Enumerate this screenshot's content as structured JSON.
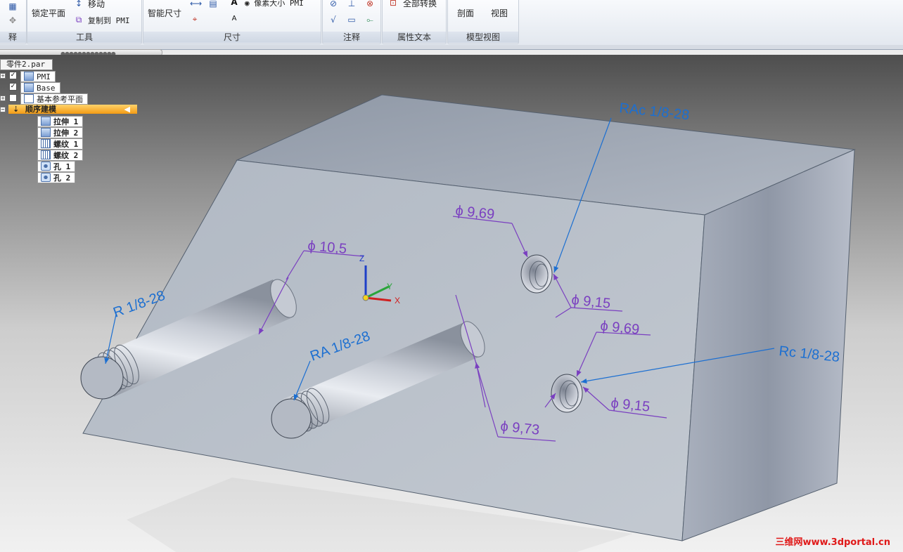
{
  "ribbon": {
    "groups": [
      {
        "label": "释"
      },
      {
        "label": "工具",
        "buttons": [
          "锁定平面",
          "移动",
          "复制到 PMI"
        ]
      },
      {
        "label": "尺寸",
        "buttons": [
          "智能尺寸",
          "像素大小 PMI"
        ]
      },
      {
        "label": "注释"
      },
      {
        "label": "属性文本",
        "buttons": [
          "全部转换"
        ]
      },
      {
        "label": "模型视图",
        "buttons": [
          "剖面",
          "视图"
        ]
      }
    ]
  },
  "tree": {
    "doc_tab": "零件2.par",
    "items": [
      {
        "label": "PMI",
        "checked": true
      },
      {
        "label": "Base",
        "checked": true
      },
      {
        "label": "基本参考平面",
        "checked": false
      },
      {
        "label": "顺序建模"
      },
      {
        "label": "拉伸 1"
      },
      {
        "label": "拉伸 2"
      },
      {
        "label": "螺纹 1"
      },
      {
        "label": "螺纹 2"
      },
      {
        "label": "孔 1"
      },
      {
        "label": "孔 2"
      }
    ]
  },
  "model": {
    "thread_labels": [
      "R 1/8-28",
      "RA 1/8-28",
      "RAc 1/8-28",
      "Rc 1/8-28"
    ],
    "dims": [
      "ϕ 10,5",
      "ϕ 9,69",
      "ϕ 9,15",
      "ϕ 9,69",
      "ϕ 9,15",
      "ϕ 9,73"
    ],
    "triad": {
      "x": "X",
      "y": "Y",
      "z": "Z"
    },
    "colors": {
      "dim": "#7a3fc0",
      "leader": "#1c6fd1",
      "face_top": "#a5adb9",
      "face_front": "#b5bcc6",
      "face_side": "#9da4b2"
    }
  },
  "watermark": "三维网www.3dportal.cn"
}
